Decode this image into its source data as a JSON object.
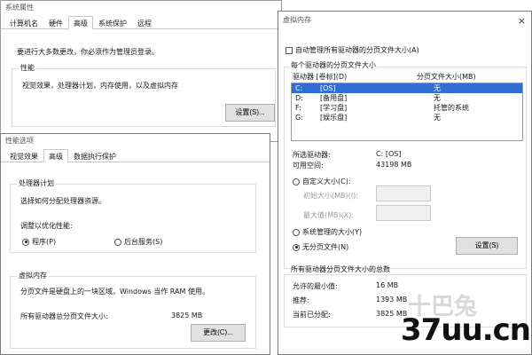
{
  "sys_props": {
    "title": "系统属性",
    "tabs": [
      "计算机名",
      "硬件",
      "高级",
      "系统保护",
      "远程"
    ],
    "admin_note": "要进行大多数更改，你必须作为管理员登录。",
    "perf_label": "性能",
    "perf_desc": "视觉效果，处理器计划，内存使用，以及虚拟内存",
    "settings_btn": "设置(S)..."
  },
  "perf_options": {
    "title": "性能选项",
    "tabs": [
      "视觉效果",
      "高级",
      "数据执行保护"
    ],
    "cpu_group": "处理器计划",
    "cpu_desc": "选择如何分配处理器资源。",
    "adjust_label": "调整以优化性能:",
    "opt_programs": "程序(P)",
    "opt_services": "后台服务(S)",
    "vm_group": "虚拟内存",
    "vm_desc": "分页文件是硬盘上的一块区域，Windows 当作 RAM 使用。",
    "vm_total_label": "所有驱动器总分页文件大小:",
    "vm_total_value": "3825 MB",
    "change_btn": "更改(C)..."
  },
  "virtual_memory": {
    "title": "虚拟内存",
    "close": "×",
    "auto_manage": "自动管理所有驱动器的分页文件大小(A)",
    "per_drive_label": "每个驱动器的分页文件大小",
    "col_drive": "驱动器 [卷标](D)",
    "col_size": "分页文件大小(MB)",
    "drives": [
      {
        "drive": "C:",
        "label": "[OS]",
        "size": "无"
      },
      {
        "drive": "D:",
        "label": "[备用盘]",
        "size": "无"
      },
      {
        "drive": "F:",
        "label": "[学习盘]",
        "size": "托管的系统"
      },
      {
        "drive": "G:",
        "label": "[娱乐盘]",
        "size": "无"
      }
    ],
    "selected_drive_label": "所选驱动器:",
    "selected_drive_value": "C:  [OS]",
    "free_space_label": "可用空间:",
    "free_space_value": "43198 MB",
    "custom_size": "自定义大小(C):",
    "initial_size": "初始大小(MB)(I):",
    "max_size": "最大值(MB)(X):",
    "system_managed": "系统管理的大小(Y)",
    "no_paging": "无分页文件(N)",
    "set_btn": "设置(S)",
    "totals_title": "所有驱动器分页文件大小的总数",
    "min_allowed_label": "允许的最小值:",
    "min_allowed_value": "16 MB",
    "recommended_label": "推荐:",
    "recommended_value": "1393 MB",
    "current_label": "当前已分配:",
    "current_value": "3825 MB"
  },
  "watermark": {
    "text": "37uu.cn",
    "ghost": "十巴兔"
  }
}
